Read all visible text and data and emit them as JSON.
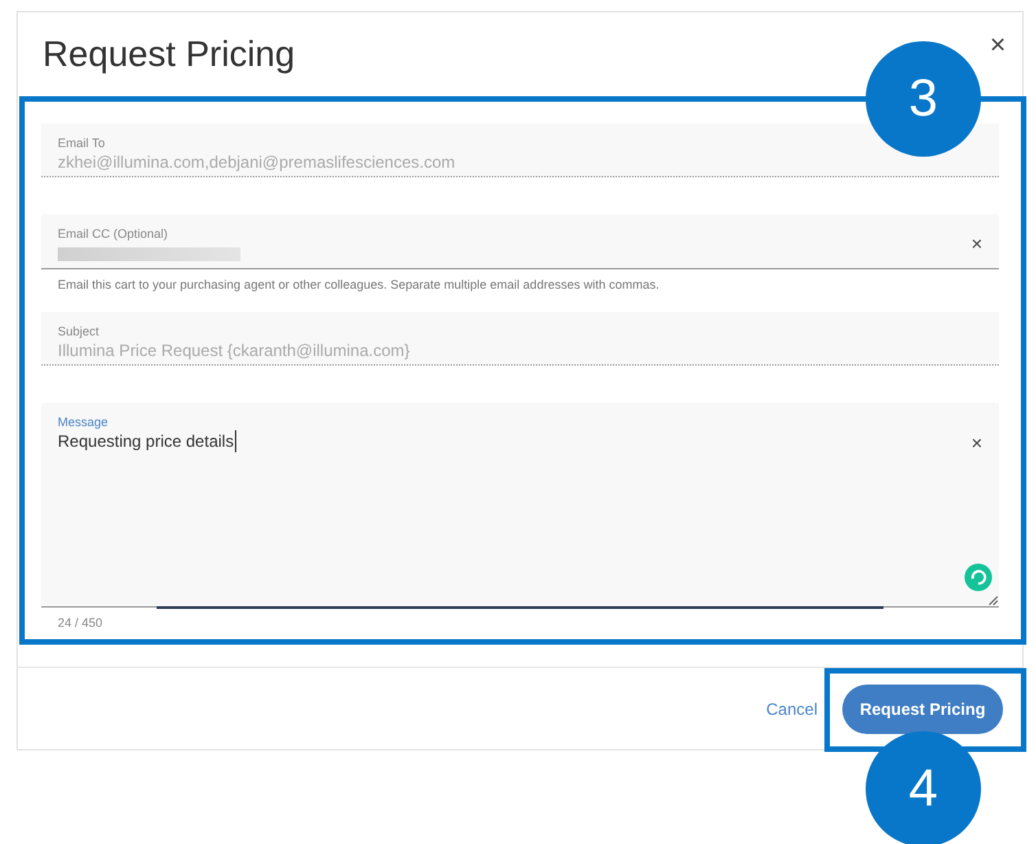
{
  "dialog": {
    "title": "Request Pricing",
    "close": "×"
  },
  "fields": [
    {
      "kind": "readonly",
      "label": "Email To",
      "value": "zkhei@illumina.com,debjani@premaslifesciences.com"
    },
    {
      "kind": "redacted",
      "label": "Email CC (Optional)",
      "clear": "×",
      "helper": "Email this cart to your purchasing agent or other colleagues. Separate multiple email addresses with commas."
    },
    {
      "kind": "readonly",
      "label": "Subject",
      "value": "Illumina Price Request {ckaranth@illumina.com}"
    },
    {
      "kind": "textarea",
      "label": "Message",
      "value": "Requesting price details",
      "clear": "×",
      "counter": "24 / 450"
    }
  ],
  "footer": {
    "cancel": "Cancel",
    "submit": "Request Pricing"
  },
  "callouts": [
    "3",
    "4"
  ]
}
